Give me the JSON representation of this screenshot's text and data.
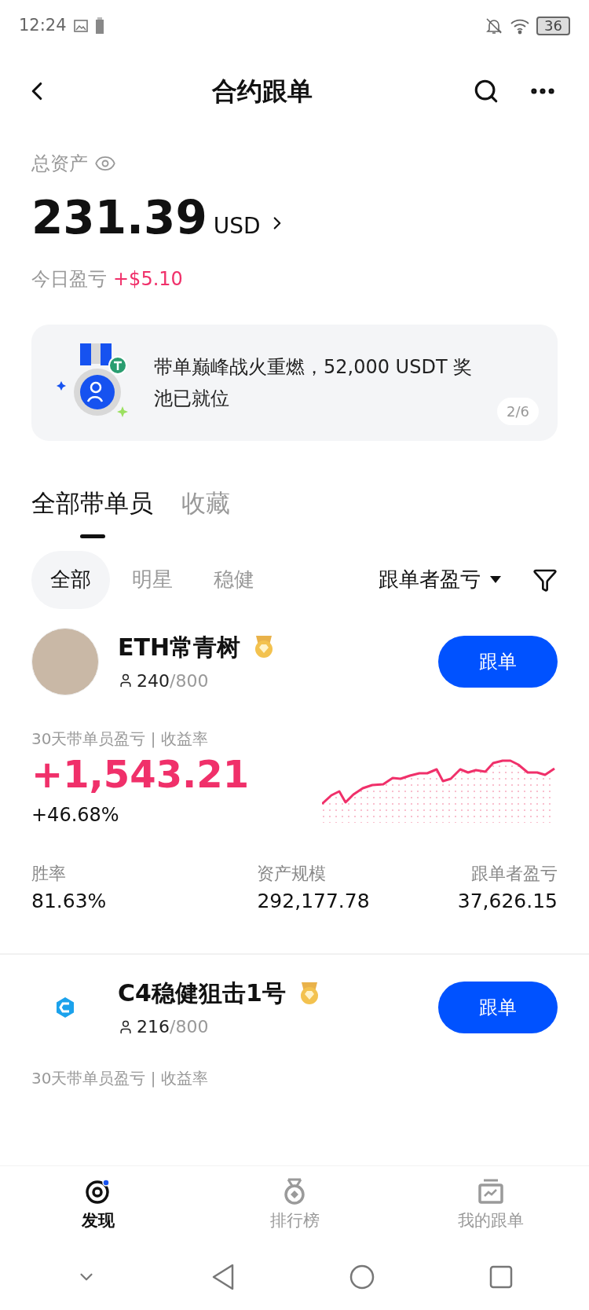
{
  "status_bar": {
    "time": "12:24",
    "battery": "36"
  },
  "header": {
    "title": "合约跟单"
  },
  "assets": {
    "label": "总资产",
    "amount": "231.39",
    "currency": "USD",
    "today_label": "今日盈亏",
    "today_value": "+$5.10"
  },
  "banner": {
    "text": "带单巅峰战火重燃，52,000 USDT 奖池已就位",
    "page": "2/6"
  },
  "tabs": [
    {
      "label": "全部带单员",
      "selected": true
    },
    {
      "label": "收藏",
      "selected": false
    }
  ],
  "filters": [
    {
      "label": "全部",
      "selected": true
    },
    {
      "label": "明星",
      "selected": false
    },
    {
      "label": "稳健",
      "selected": false
    }
  ],
  "sort": {
    "label": "跟单者盈亏"
  },
  "traders": [
    {
      "kind": "photo",
      "name": "ETH常青树",
      "followers": "240",
      "capacity": "/800",
      "button": "跟单",
      "pnl_label": "30天带单员盈亏 | 收益率",
      "pnl": "+1,543.21",
      "roi": "+46.68%",
      "stats": [
        {
          "label": "胜率",
          "value": "81.63%"
        },
        {
          "label": "资产规模",
          "value": "292,177.78"
        },
        {
          "label": "跟单者盈亏",
          "value": "37,626.15"
        }
      ]
    },
    {
      "kind": "logo",
      "name": "C4稳健狙击1号",
      "followers": "216",
      "capacity": "/800",
      "button": "跟单",
      "pnl_label": "30天带单员盈亏 | 收益率"
    }
  ],
  "bottom_nav": [
    {
      "label": "发现",
      "selected": true
    },
    {
      "label": "排行榜",
      "selected": false
    },
    {
      "label": "我的跟单",
      "selected": false
    }
  ]
}
